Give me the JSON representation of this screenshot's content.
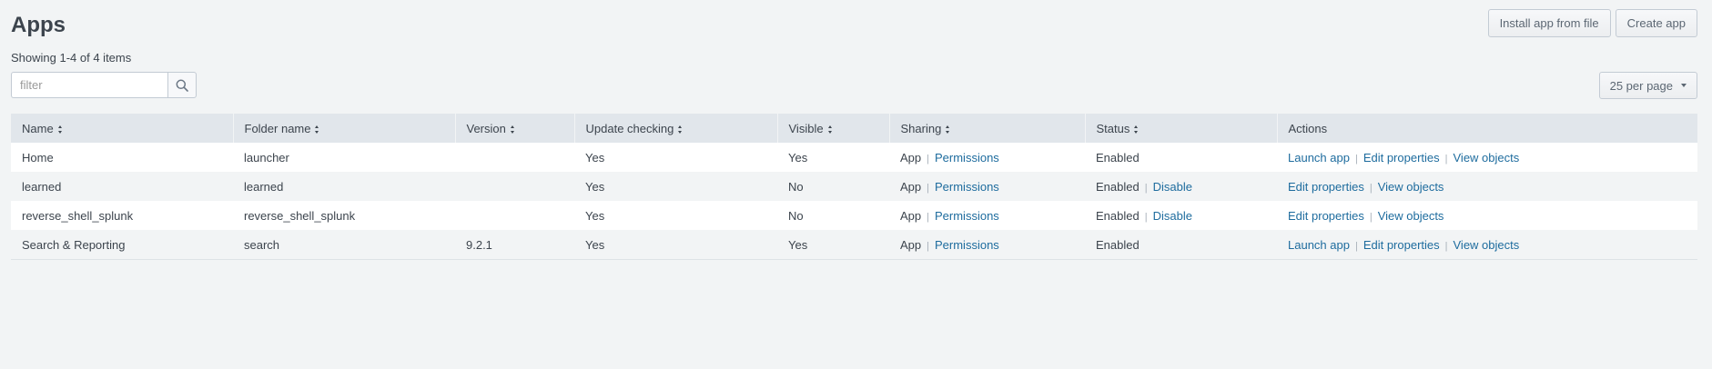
{
  "page": {
    "title": "Apps",
    "showing": "Showing 1-4 of 4 items",
    "filter_placeholder": "filter",
    "install_button": "Install app from file",
    "create_button": "Create app",
    "per_page": "25 per page"
  },
  "table": {
    "columns": [
      "Name",
      "Folder name",
      "Version",
      "Update checking",
      "Visible",
      "Sharing",
      "Status",
      "Actions"
    ],
    "rows": [
      {
        "name": "Home",
        "folder": "launcher",
        "version": "",
        "update": "Yes",
        "visible": "Yes",
        "sharing": "App",
        "permissions": "Permissions",
        "status": "Enabled",
        "disable": "",
        "actions": [
          "Launch app",
          "Edit properties",
          "View objects"
        ]
      },
      {
        "name": "learned",
        "folder": "learned",
        "version": "",
        "update": "Yes",
        "visible": "No",
        "sharing": "App",
        "permissions": "Permissions",
        "status": "Enabled",
        "disable": "Disable",
        "actions": [
          "Edit properties",
          "View objects"
        ]
      },
      {
        "name": "reverse_shell_splunk",
        "folder": "reverse_shell_splunk",
        "version": "",
        "update": "Yes",
        "visible": "No",
        "sharing": "App",
        "permissions": "Permissions",
        "status": "Enabled",
        "disable": "Disable",
        "actions": [
          "Edit properties",
          "View objects"
        ]
      },
      {
        "name": "Search & Reporting",
        "folder": "search",
        "version": "9.2.1",
        "update": "Yes",
        "visible": "Yes",
        "sharing": "App",
        "permissions": "Permissions",
        "status": "Enabled",
        "disable": "",
        "actions": [
          "Launch app",
          "Edit properties",
          "View objects"
        ]
      }
    ]
  },
  "colors": {
    "link": "#1e6c9e",
    "header_bg": "#e1e6eb",
    "page_bg": "#f2f4f5"
  },
  "icons": {
    "search": "search-icon",
    "sort": "sort-icon",
    "caret": "caret-down-icon"
  }
}
